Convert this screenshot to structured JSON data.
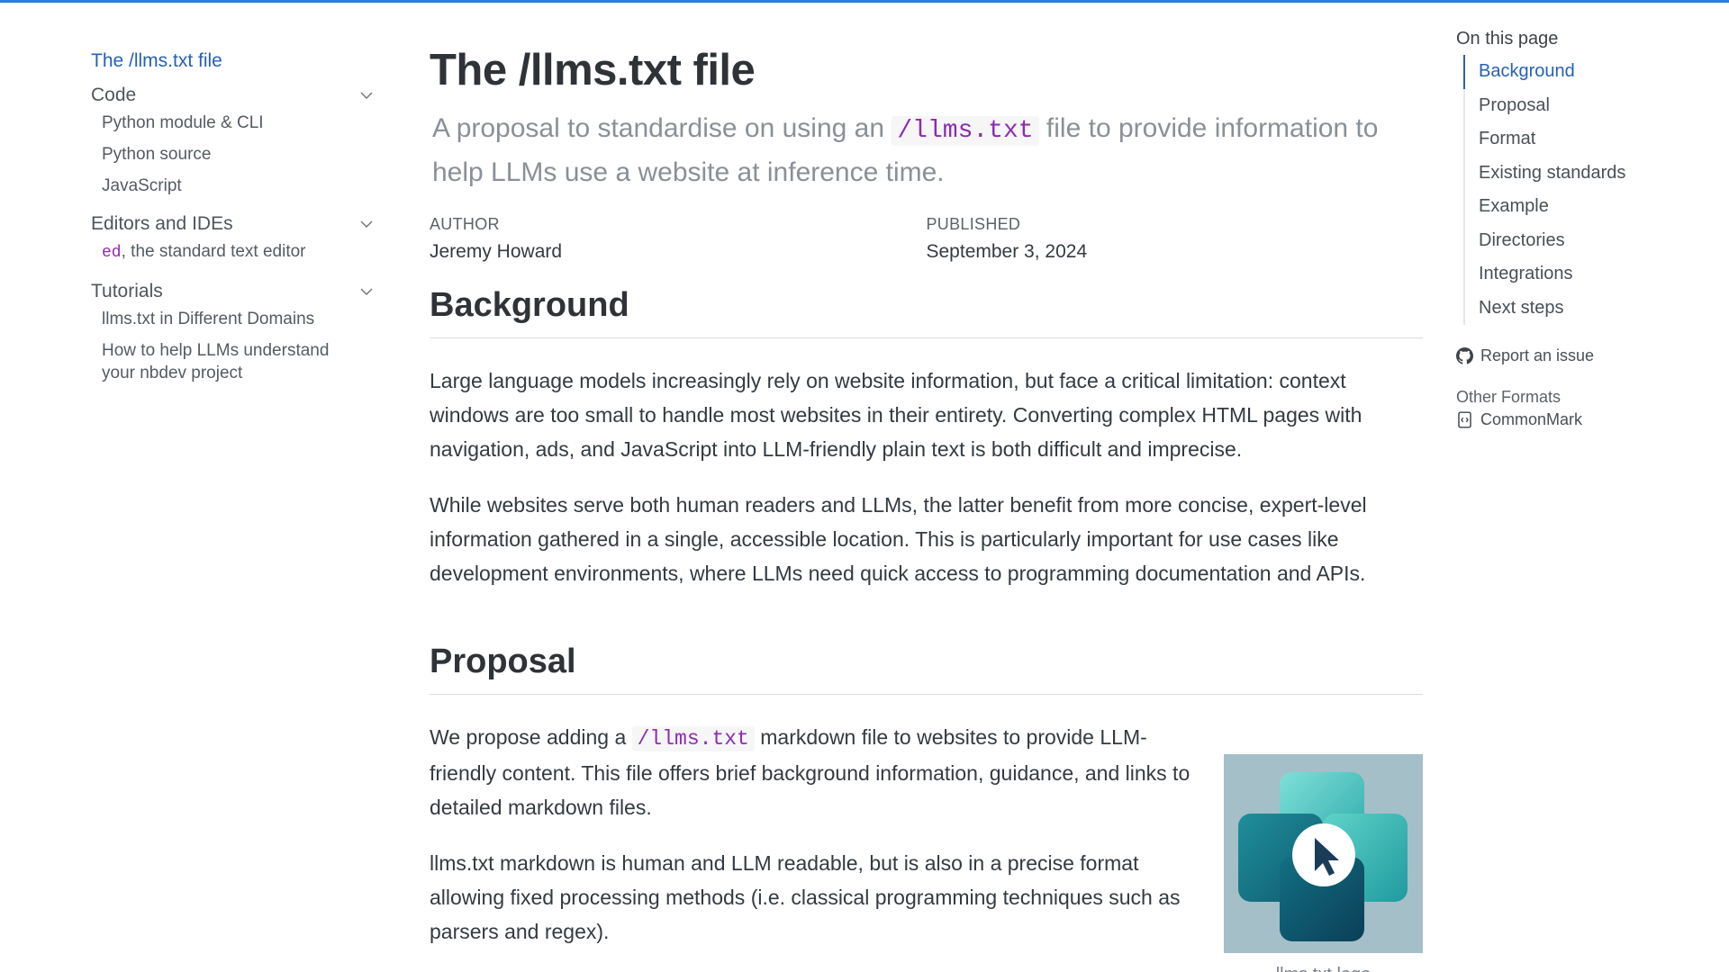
{
  "sidebar": {
    "active_link": "The /llms.txt file",
    "sections": [
      {
        "label": "Code",
        "items": [
          "Python module & CLI",
          "Python source",
          "JavaScript"
        ]
      },
      {
        "label": "Editors and IDEs",
        "item_code": "ed",
        "item_rest": ", the standard text editor"
      },
      {
        "label": "Tutorials",
        "items": [
          "llms.txt in Different Domains",
          "How to help LLMs understand your nbdev project"
        ]
      }
    ],
    "chevron_icon": "chevron-down-icon"
  },
  "main": {
    "title": "The /llms.txt file",
    "subtitle_pre": "A proposal to standardise on using an ",
    "subtitle_code": "/llms.txt",
    "subtitle_post": " file to provide information to help LLMs use a website at inference time.",
    "author_label": "Author",
    "author": "Jeremy Howard",
    "published_label": "Published",
    "published": "September 3, 2024",
    "background": {
      "heading": "Background",
      "paragraphs": [
        "Large language models increasingly rely on website information, but face a critical limitation: context windows are too small to handle most websites in their entirety. Converting complex HTML pages with navigation, ads, and JavaScript into LLM-friendly plain text is both difficult and imprecise.",
        "While websites serve both human readers and LLMs, the latter benefit from more concise, expert-level information gathered in a single, accessible location. This is particularly important for use cases like development environments, where LLMs need quick access to programming documentation and APIs."
      ]
    },
    "proposal": {
      "heading": "Proposal",
      "p1_pre": "We propose adding a ",
      "p1_code": "/llms.txt",
      "p1_post": " markdown file to websites to provide LLM-friendly content. This file offers brief background information, guidance, and links to detailed markdown files.",
      "p2": "llms.txt markdown is human and LLM readable, but is also in a precise format allowing fixed processing methods (i.e. classical programming techniques such as parsers and regex).",
      "logo_caption": "llms.txt logo"
    }
  },
  "toc": {
    "title": "On this page",
    "items": [
      "Background",
      "Proposal",
      "Format",
      "Existing standards",
      "Example",
      "Directories",
      "Integrations",
      "Next steps"
    ],
    "active": "Background",
    "report_issue": "Report an issue",
    "other_formats_label": "Other Formats",
    "commonmark": "CommonMark"
  },
  "colors": {
    "accent": "#2761b5",
    "top_bar": "#2780e3",
    "code": "#8f2bb0"
  }
}
